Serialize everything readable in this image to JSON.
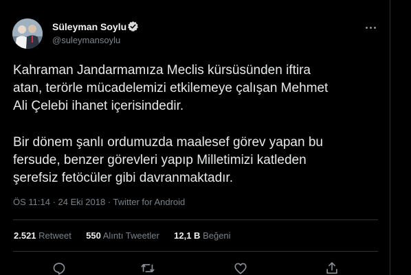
{
  "tweet": {
    "author": {
      "display_name": "Süleyman Soylu",
      "username": "@suleymansoylu",
      "verified": true
    },
    "paragraph1": [
      "Kahraman Jandarmamıza Meclis kürsüsünden iftira",
      "atan, terörle mücadelemizi etkilemeye çalışan Mehmet",
      "Ali Çelebi ihanet içerisindedir."
    ],
    "paragraph2": [
      "Bir dönem şanlı ordumuzda maalesef görev yapan bu",
      "fersude, benzer görevleri yapıp Milletimizi katleden",
      "şerefsiz fetöcüler gibi davranmaktadır."
    ],
    "meta": "ÖS 11:14 · 24 Eki 2018 · Twitter for Android",
    "stats": {
      "retweets_value": "2.521",
      "retweets_label": "Retweet",
      "quotes_value": "550",
      "quotes_label": "Alıntı Tweetler",
      "likes_value": "12,1 B",
      "likes_label": "Beğeni"
    },
    "actions": [
      "reply-icon",
      "retweet-icon",
      "heart-icon",
      "share-icon"
    ]
  },
  "colors": {
    "background": "#000000",
    "text": "#e7e9ea",
    "secondary": "#7a8288",
    "divider": "#2f3336",
    "verified": "#d9d9d9"
  }
}
